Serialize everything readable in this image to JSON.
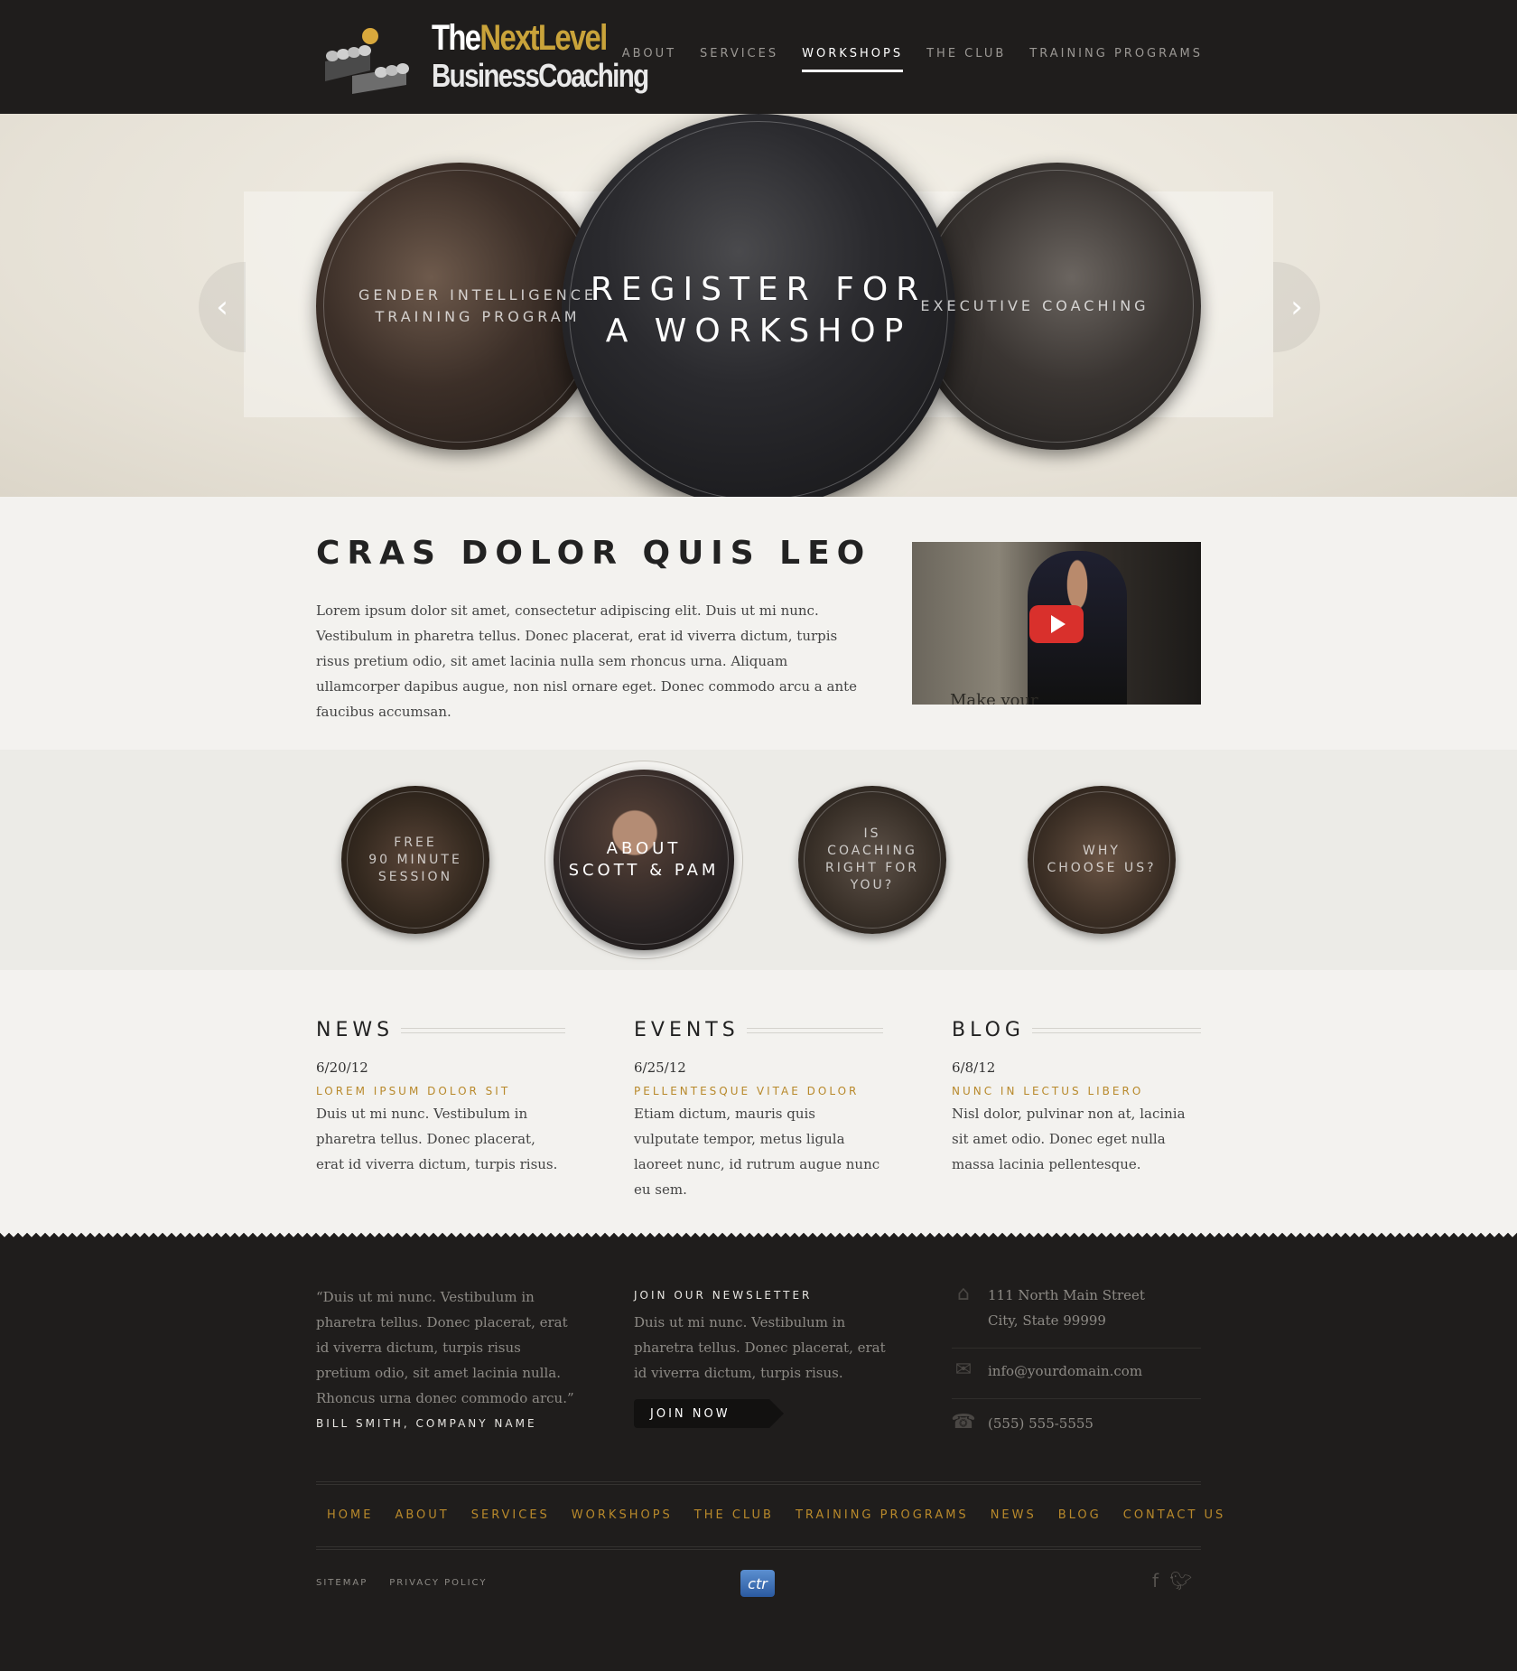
{
  "header": {
    "logo": {
      "line1_a": "The",
      "line1_b": "NextLevel",
      "line2": "BusinessCoaching"
    },
    "nav": [
      "ABOUT",
      "SERVICES",
      "WORKSHOPS",
      "THE CLUB",
      "TRAINING PROGRAMS"
    ],
    "active_nav": "WORKSHOPS"
  },
  "hero": {
    "prev_icon": "chevron-left-icon",
    "next_icon": "chevron-right-icon",
    "left_label": "GENDER INTELLIGENCE\nTRAINING PROGRAM",
    "main_label": "REGISTER FOR\nA WORKSHOP",
    "right_label": "EXECUTIVE COACHING"
  },
  "intro": {
    "title": "CRAS DOLOR QUIS LEO",
    "text": "Lorem ipsum dolor sit amet, consectetur adipiscing elit. Duis ut mi nunc. Vestibulum in pharetra tellus. Donec placerat, erat id viverra dictum, turpis risus pretium odio, sit amet lacinia nulla sem rhoncus urna. Aliquam ullamcorper dapibus augue, non nisl ornare eget. Donec commodo arcu a ante faucibus accumsan.",
    "video_caption": "Make your",
    "play_icon": "play-icon"
  },
  "features": [
    "FREE\n90 MINUTE\nSESSION",
    "ABOUT\nSCOTT & PAM",
    "IS\nCOACHING\nRIGHT FOR\nYOU?",
    "WHY\nCHOOSE US?"
  ],
  "columns": [
    {
      "heading": "NEWS",
      "date": "6/20/12",
      "subtitle": "LOREM IPSUM DOLOR SIT",
      "body": "Duis ut mi nunc. Vestibulum in pharetra tellus. Donec placerat, erat id viverra dictum, turpis risus."
    },
    {
      "heading": "EVENTS",
      "date": "6/25/12",
      "subtitle": "PELLENTESQUE VITAE DOLOR",
      "body": "Etiam dictum, mauris quis vulputate tempor, metus ligula laoreet nunc, id rutrum augue nunc eu sem."
    },
    {
      "heading": "BLOG",
      "date": "6/8/12",
      "subtitle": "NUNC IN LECTUS LIBERO",
      "body": "Nisl dolor, pulvinar non at, lacinia sit amet odio. Donec eget nulla massa lacinia pellentesque."
    }
  ],
  "footer": {
    "quote": "“Duis ut mi nunc. Vestibulum in pharetra tellus. Donec placerat, erat id viverra dictum, turpis risus pretium odio, sit amet lacinia nulla. Rhoncus urna  donec commodo arcu.”",
    "quote_author": "BILL SMITH, COMPANY NAME",
    "newsletter_title": "JOIN OUR NEWSLETTER",
    "newsletter_text": "Duis ut mi nunc. Vestibulum in pharetra tellus. Donec placerat, erat id viverra dictum, turpis risus.",
    "join_label": "JOIN NOW",
    "address_line1": "111 North Main Street",
    "address_line2": "City, State 99999",
    "email": "info@yourdomain.com",
    "phone": "(555) 555-5555",
    "home_icon": "home-icon",
    "mail_icon": "mail-icon",
    "phone_icon": "phone-icon",
    "nav": [
      "HOME",
      "ABOUT",
      "SERVICES",
      "WORKSHOPS",
      "THE CLUB",
      "TRAINING PROGRAMS",
      "NEWS",
      "BLOG",
      "CONTACT US"
    ],
    "legal": [
      "SITEMAP",
      "PRIVACY POLICY"
    ],
    "badge_text": "ctr",
    "social_icons": [
      "facebook-icon",
      "twitter-icon"
    ]
  },
  "colors": {
    "dark": "#1f1d1c",
    "gold": "#b8892b",
    "light_bg": "#f3f2ef"
  }
}
